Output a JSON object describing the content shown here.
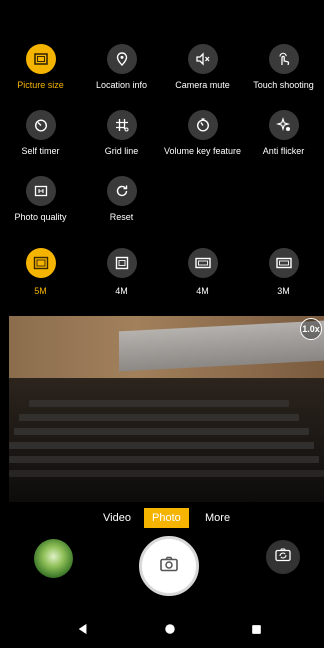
{
  "colors": {
    "accent": "#f5b400",
    "icon_bg": "#3a3a3a",
    "background": "#000000"
  },
  "settings": [
    {
      "label": "Picture size",
      "icon": "picture-size-icon",
      "active": true
    },
    {
      "label": "Location info",
      "icon": "location-pin-icon",
      "active": false
    },
    {
      "label": "Camera mute",
      "icon": "speaker-mute-icon",
      "active": false
    },
    {
      "label": "Touch shooting",
      "icon": "touch-hand-icon",
      "active": false
    },
    {
      "label": "Self timer",
      "icon": "timer-icon",
      "active": false
    },
    {
      "label": "Grid line",
      "icon": "grid-icon",
      "active": false
    },
    {
      "label": "Volume key feature",
      "icon": "volume-key-icon",
      "active": false
    },
    {
      "label": "Anti flicker",
      "icon": "anti-flicker-icon",
      "active": false
    },
    {
      "label": "Photo quality",
      "icon": "photo-quality-icon",
      "active": false
    },
    {
      "label": "Reset",
      "icon": "reset-icon",
      "active": false
    }
  ],
  "picture_sizes": [
    {
      "label": "5M",
      "ratio": "4:3",
      "active": true
    },
    {
      "label": "4M",
      "ratio": "1:1",
      "active": false
    },
    {
      "label": "4M",
      "ratio": "16:9",
      "active": false
    },
    {
      "label": "3M",
      "ratio": "16:9",
      "active": false
    }
  ],
  "viewfinder": {
    "zoom": "1.0x"
  },
  "modes": {
    "video": "Video",
    "photo": "Photo",
    "more": "More"
  },
  "controls": {
    "gallery": "gallery-thumbnail",
    "shutter": "camera-icon",
    "switch": "switch-camera-icon"
  },
  "nav": {
    "back": "back-triangle-icon",
    "home": "home-circle-icon",
    "recents": "recents-square-icon"
  }
}
